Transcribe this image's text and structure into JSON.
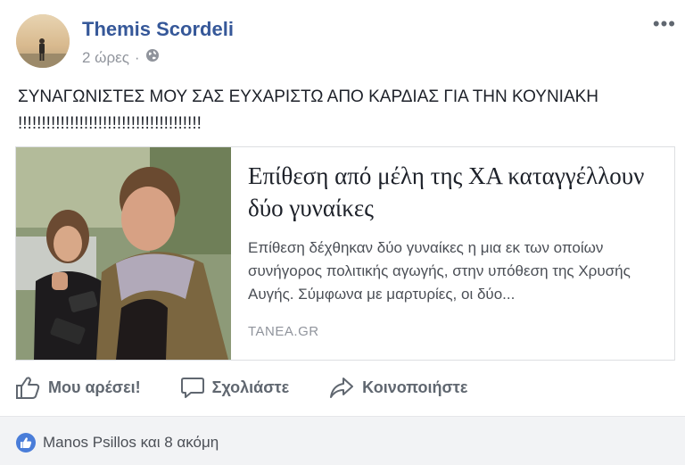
{
  "post": {
    "author": "Themis Scordeli",
    "time": "2 ώρες",
    "separator": "·",
    "privacy_icon": "globe-icon",
    "more_icon": "ellipsis-icon",
    "text": "ΣΥΝΑΓΩΝΙΣΤΕΣ ΜΟΥ ΣΑΣ ΕΥΧΑΡΙΣΤΩ ΑΠΟ ΚΑΡΔΙΑΣ ΓΙΑ ΤΗΝ ΚΟΥΝΙΑΚΗ !!!!!!!!!!!!!!!!!!!!!!!!!!!!!!!!!!!!!!!"
  },
  "link_card": {
    "headline": "Επίθεση από μέλη της ΧΑ καταγγέλλουν δύο γυναίκες",
    "description": "Επίθεση δέχθηκαν δύο γυναίκες η μια εκ των οποίων συνήγορος πολιτικής αγωγής, στην υπόθεση της Χρυσής Αυγής. Σύμφωνα με μαρτυρίες, οι δύο...",
    "domain": "TANEA.GR"
  },
  "actions": {
    "like_label": "Μου αρέσει!",
    "comment_label": "Σχολιάστε",
    "share_label": "Κοινοποιήστε"
  },
  "reactions": {
    "summary": "Manos Psillos και 8 ακόμη"
  },
  "colors": {
    "author": "#365899",
    "muted": "#90949c",
    "action": "#606770",
    "like_badge": "#4a7dd9"
  }
}
